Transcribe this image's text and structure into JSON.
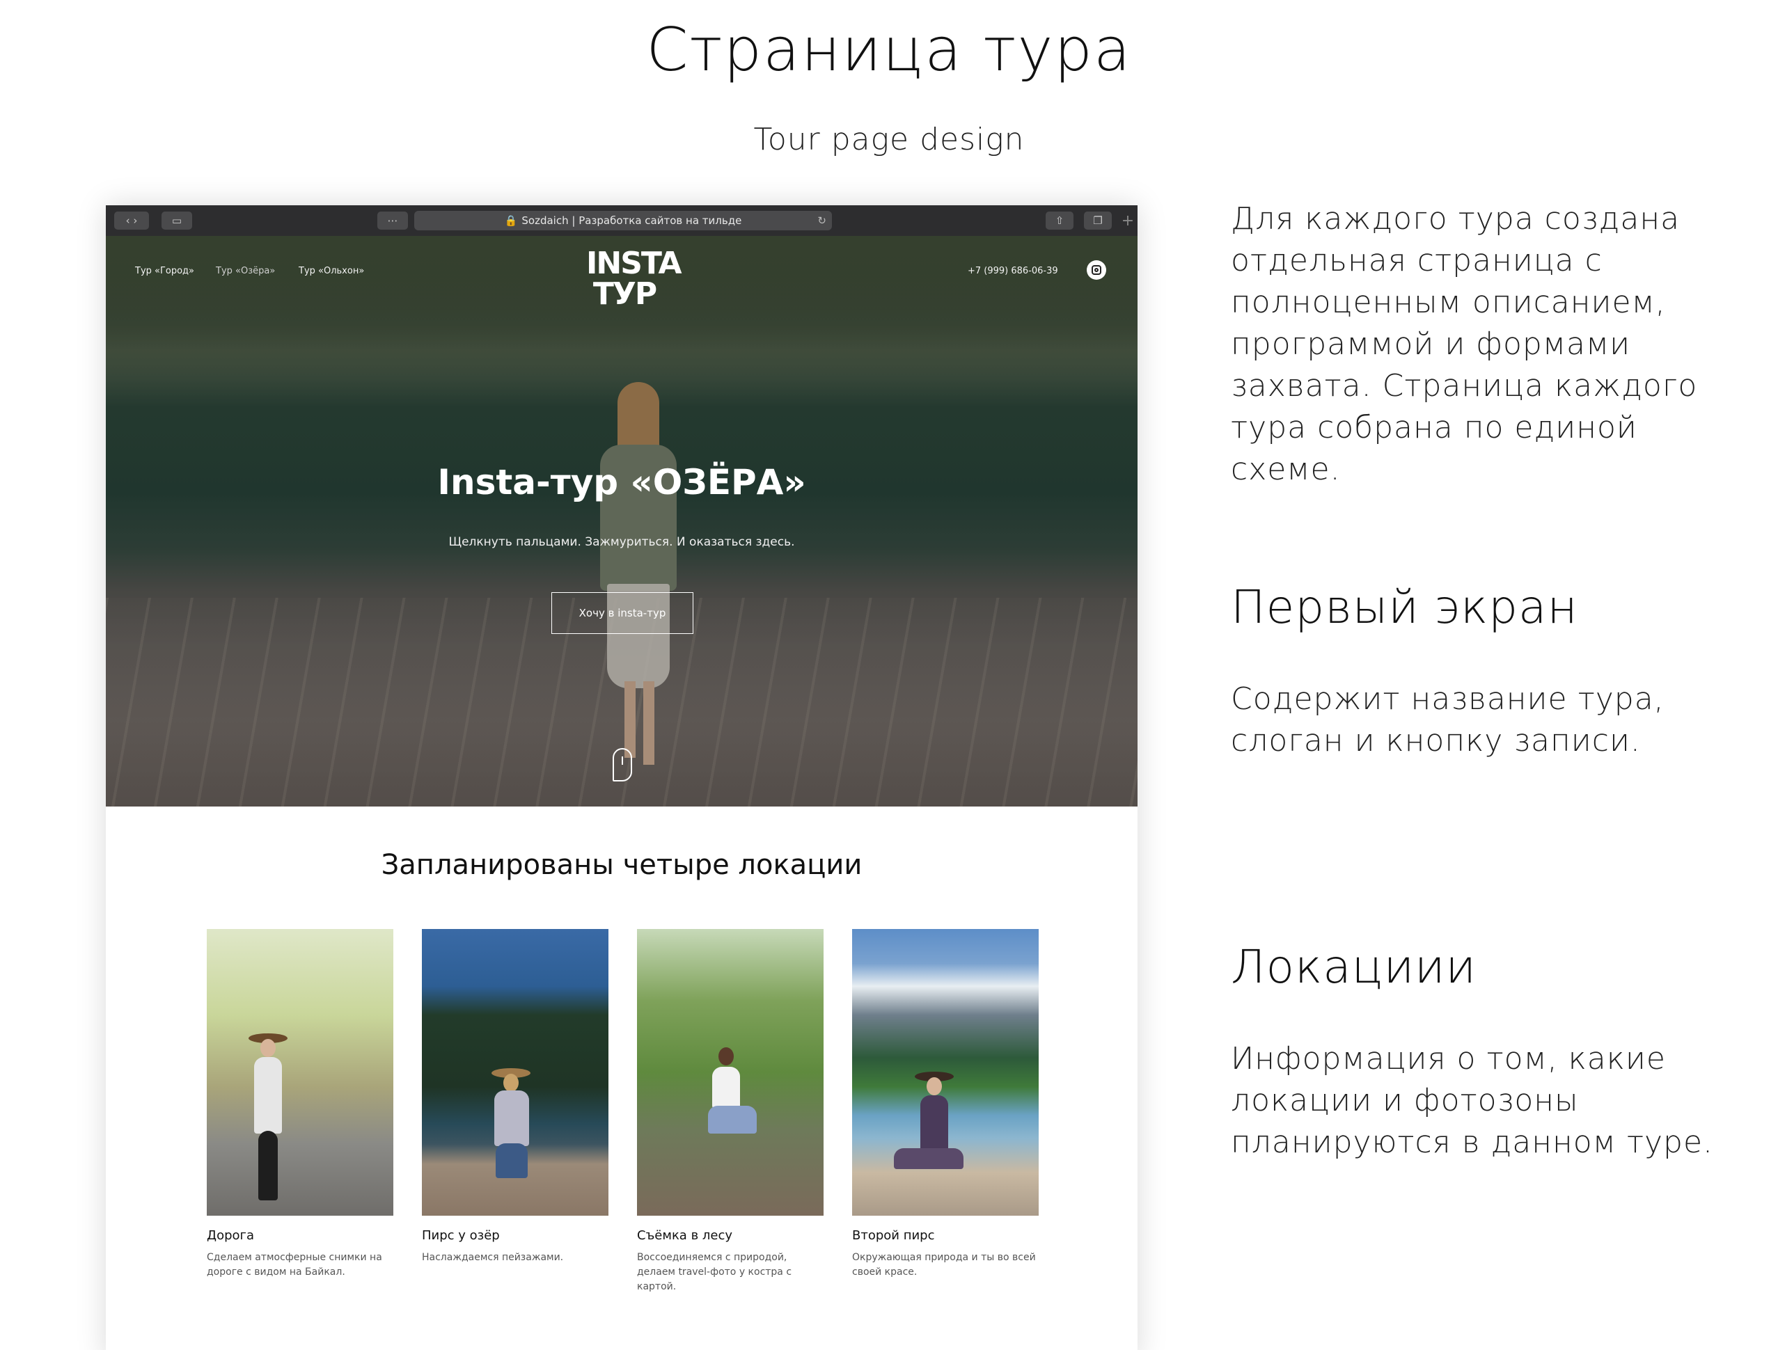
{
  "presentation": {
    "title": "Страница тура",
    "subtitle": "Tour page design"
  },
  "browser": {
    "address": "Sozdaich | Разработка сайтов на тильде"
  },
  "site": {
    "nav": [
      "Тур «Город»",
      "Тур «Озёра»",
      "Тур «Ольхон»"
    ],
    "logo_line1": "INSTA",
    "logo_line2": "ТУР",
    "phone": "+7 (999) 686-06-39"
  },
  "hero": {
    "title": "Insta-тур «ОЗЁРА»",
    "slogan": "Щелкнуть пальцами. Зажмуриться. И оказаться здесь.",
    "cta": "Хочу в insta-тур"
  },
  "locations": {
    "title": "Запланированы четыре локации",
    "items": [
      {
        "name": "Дорога",
        "desc": "Сделаем атмосферные снимки на дороге с видом на Байкал."
      },
      {
        "name": "Пирс у озёр",
        "desc": "Наслаждаемся пейзажами."
      },
      {
        "name": "Съёмка в лесу",
        "desc": "Воссоединяемся с природой, делаем travel-фото у костра с картой."
      },
      {
        "name": "Второй пирс",
        "desc": "Окружающая природа и ты во всей своей красе."
      }
    ]
  },
  "side": {
    "intro": "Для каждого тура создана отдельная страница с полноценным описанием, программой и формами захвата. Страница каждого тура собрана по единой схеме.",
    "h1": "Первый экран",
    "p1": "Содержит название тура, слоган и кнопку записи.",
    "h2": "Локациии",
    "p2": "Информация о том, какие локации и фотозоны планируются в данном туре."
  }
}
